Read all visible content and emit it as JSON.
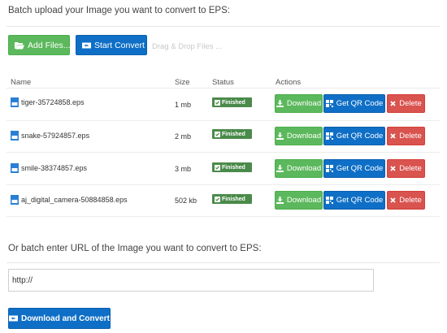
{
  "upload_heading": "Batch upload your Image you want to convert to EPS:",
  "toolbar": {
    "add_files": "Add Files...",
    "start_convert": "Start Convert",
    "drag_drop": "Drag & Drop Files ..."
  },
  "table": {
    "headers": {
      "name": "Name",
      "size": "Size",
      "status": "Status",
      "actions": "Actions"
    },
    "rows": [
      {
        "name": "tiger-35724858.eps",
        "size": "1 mb",
        "status": "Finished"
      },
      {
        "name": "snake-57924857.eps",
        "size": "2 mb",
        "status": "Finished"
      },
      {
        "name": "smile-38374857.eps",
        "size": "3 mb",
        "status": "Finished"
      },
      {
        "name": "aj_digital_camera-50884858.eps",
        "size": "502 kb",
        "status": "Finished"
      }
    ],
    "actions": {
      "download": "Download",
      "qr": "Get QR Code",
      "delete": "Delete"
    }
  },
  "url_heading": "Or batch enter URL of the Image you want to convert to EPS:",
  "url_input": {
    "value": "http://"
  },
  "download_convert": "Download and Convert",
  "colors": {
    "green": "#5cb85c",
    "blue": "#0f6fc6",
    "red": "#d9534f",
    "badge": "#4a8a4a"
  }
}
